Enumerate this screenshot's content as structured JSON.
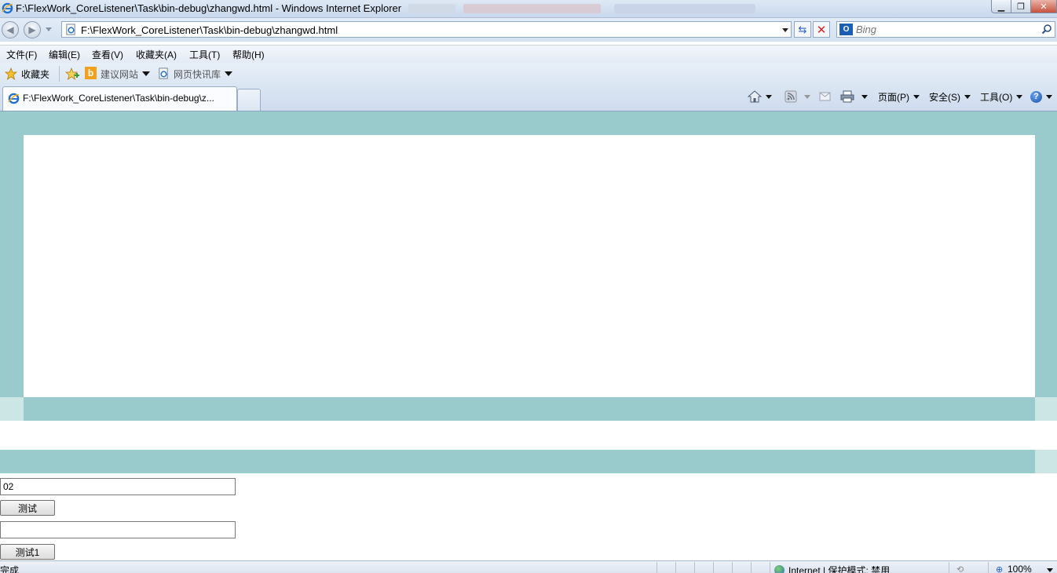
{
  "window": {
    "title": "F:\\FlexWork_CoreListener\\Task\\bin-debug\\zhangwd.html - Windows Internet Explorer",
    "minimize_label": "▁",
    "maximize_label": "❐",
    "close_label": "✕"
  },
  "address_bar": {
    "url": "F:\\FlexWork_CoreListener\\Task\\bin-debug\\zhangwd.html"
  },
  "search": {
    "placeholder": "Bing",
    "logo": "O"
  },
  "menu": {
    "items": [
      "文件(F)",
      "编辑(E)",
      "查看(V)",
      "收藏夹(A)",
      "工具(T)",
      "帮助(H)"
    ]
  },
  "favorites_bar": {
    "favorites_label": "收藏夹",
    "suggested_sites": "建议网站",
    "web_slice_gallery": "网页快讯库"
  },
  "tabs": {
    "active_title": "F:\\FlexWork_CoreListener\\Task\\bin-debug\\z..."
  },
  "command_bar": {
    "page": "页面(P)",
    "safety": "安全(S)",
    "tools": "工具(O)",
    "help": "?"
  },
  "page": {
    "input1_value": "02",
    "button1_label": "测试",
    "input2_value": "",
    "button2_label": "测试1"
  },
  "status_bar": {
    "status": "完成",
    "zone": "Internet | 保护模式: 禁用",
    "zoom": "100%"
  },
  "colors": {
    "flash_background": "#99cbcc",
    "band_light": "#cce5e5"
  }
}
